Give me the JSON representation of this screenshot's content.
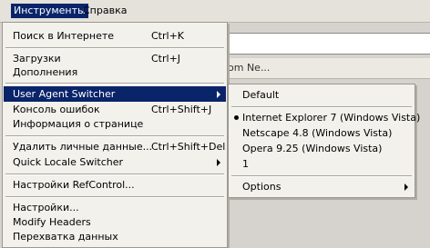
{
  "menubar": {
    "tools": "Инструменты",
    "help": "Справка"
  },
  "background": {
    "strip_text": "om Ne..."
  },
  "tools_menu": {
    "items": [
      {
        "label": "Поиск в Интернете",
        "shortcut": "Ctrl+K"
      },
      {
        "label": "Загрузки",
        "shortcut": "Ctrl+J"
      },
      {
        "label": "Дополнения",
        "shortcut": ""
      },
      {
        "label": "User Agent Switcher",
        "shortcut": ""
      },
      {
        "label": "Консоль ошибок",
        "shortcut": "Ctrl+Shift+J"
      },
      {
        "label": "Информация о странице",
        "shortcut": ""
      },
      {
        "label": "Удалить личные данные...",
        "shortcut": "Ctrl+Shift+Del"
      },
      {
        "label": "Quick Locale Switcher",
        "shortcut": ""
      },
      {
        "label": "Настройки RefControl...",
        "shortcut": ""
      },
      {
        "label": "Настройки...",
        "shortcut": ""
      },
      {
        "label": "Modify Headers",
        "shortcut": ""
      },
      {
        "label": "Перехватка данных",
        "shortcut": ""
      }
    ]
  },
  "ua_submenu": {
    "items": [
      {
        "label": "Default"
      },
      {
        "label": "Internet Explorer 7 (Windows Vista)",
        "selected": true
      },
      {
        "label": "Netscape 4.8 (Windows Vista)"
      },
      {
        "label": "Opera 9.25 (Windows Vista)"
      },
      {
        "label": "1"
      },
      {
        "label": "Options"
      }
    ]
  },
  "colors": {
    "highlight": "#0a246a",
    "menu_bg": "#f3f1ec"
  }
}
